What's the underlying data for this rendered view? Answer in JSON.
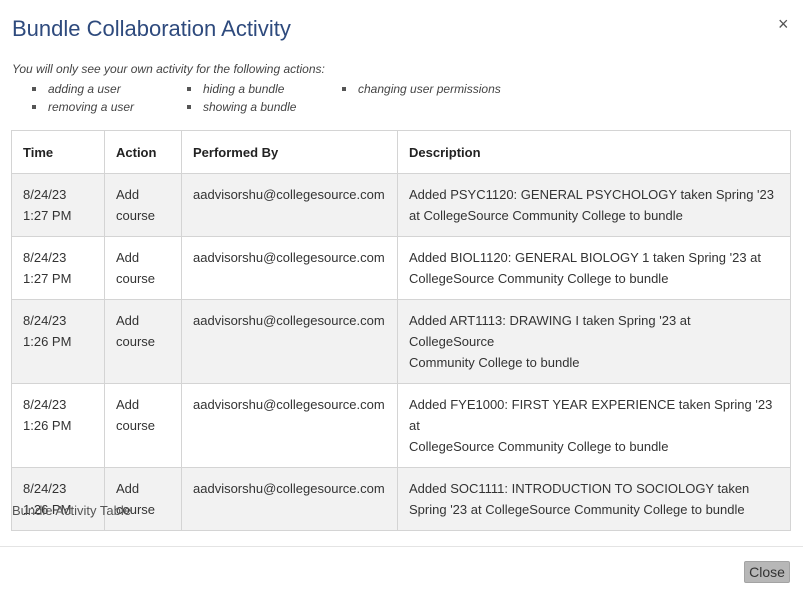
{
  "modal": {
    "title": "Bundle Collaboration Activity",
    "close_icon": "×",
    "intro": "You will only see your own activity for the following actions:",
    "actions": [
      "adding a user",
      "removing a user",
      "hiding a bundle",
      "showing a bundle",
      "changing user permissions"
    ]
  },
  "table": {
    "headers": [
      "Time",
      "Action",
      "Performed By",
      "Description"
    ],
    "rows": [
      {
        "date": "8/24/23",
        "time": "1:27 PM",
        "action1": "Add",
        "action2": "course",
        "by": "aadvisorshu@collegesource.com",
        "desc1": "Added PSYC1120: GENERAL PSYCHOLOGY taken Spring '23",
        "desc2": "at CollegeSource Community College to bundle"
      },
      {
        "date": "8/24/23",
        "time": "1:27 PM",
        "action1": "Add",
        "action2": "course",
        "by": "aadvisorshu@collegesource.com",
        "desc1": "Added BIOL1120: GENERAL BIOLOGY 1 taken Spring '23 at",
        "desc2": "CollegeSource Community College to bundle"
      },
      {
        "date": "8/24/23",
        "time": "1:26 PM",
        "action1": "Add",
        "action2": "course",
        "by": "aadvisorshu@collegesource.com",
        "desc1": "Added ART1113: DRAWING I taken Spring '23 at CollegeSource",
        "desc2": "Community College to bundle"
      },
      {
        "date": "8/24/23",
        "time": "1:26 PM",
        "action1": "Add",
        "action2": "course",
        "by": "aadvisorshu@collegesource.com",
        "desc1": "Added FYE1000: FIRST YEAR EXPERIENCE taken Spring '23 at",
        "desc2": "CollegeSource Community College to bundle"
      },
      {
        "date": "8/24/23",
        "time": "1:26 PM",
        "action1": "Add",
        "action2": "course",
        "by": "aadvisorshu@collegesource.com",
        "desc1": "Added SOC1111: INTRODUCTION TO SOCIOLOGY taken",
        "desc2": "Spring '23 at CollegeSource Community College to bundle"
      }
    ],
    "caption": "Bundle Activity Table"
  },
  "footer": {
    "close_label": "Close"
  },
  "colors": {
    "title": "#2e4a7d",
    "row_stripe": "#f2f2f2",
    "button": "#b7b7b7"
  }
}
